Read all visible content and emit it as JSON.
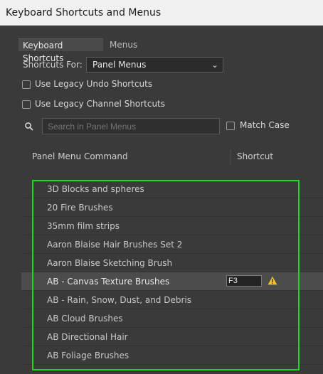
{
  "window": {
    "title": "Keyboard Shortcuts and Menus"
  },
  "tabs": [
    {
      "label": "Keyboard Shortcuts",
      "active": true
    },
    {
      "label": "Menus",
      "active": false
    }
  ],
  "shortcuts_for": {
    "label": "Shortcuts For:",
    "value": "Panel Menus"
  },
  "options": {
    "legacy_undo": {
      "label": "Use Legacy Undo Shortcuts",
      "checked": false
    },
    "legacy_channel": {
      "label": "Use Legacy Channel Shortcuts",
      "checked": false
    },
    "match_case": {
      "label": "Match Case",
      "checked": false
    }
  },
  "search": {
    "placeholder": "Search in Panel Menus",
    "value": ""
  },
  "table": {
    "headers": {
      "command": "Panel Menu Command",
      "shortcut": "Shortcut"
    },
    "rows": [
      {
        "label": "3D Blocks and spheres"
      },
      {
        "label": "20 Fire Brushes"
      },
      {
        "label": "35mm film strips"
      },
      {
        "label": "Aaron Blaise Hair Brushes Set 2"
      },
      {
        "label": "Aaron Blaise Sketching Brush"
      },
      {
        "label": "AB - Canvas Texture Brushes",
        "selected": true,
        "shortcut": "F3"
      },
      {
        "label": "AB - Rain, Snow, Dust, and Debris"
      },
      {
        "label": "AB Cloud Brushes"
      },
      {
        "label": "AB Directional Hair"
      },
      {
        "label": "AB Foliage Brushes"
      }
    ]
  },
  "colors": {
    "highlight": "#1fd61f",
    "warning": "#f2c12e"
  },
  "icons": {
    "search": "search-icon",
    "warning": "warning-icon",
    "dropdown": "chevron-down-icon"
  }
}
